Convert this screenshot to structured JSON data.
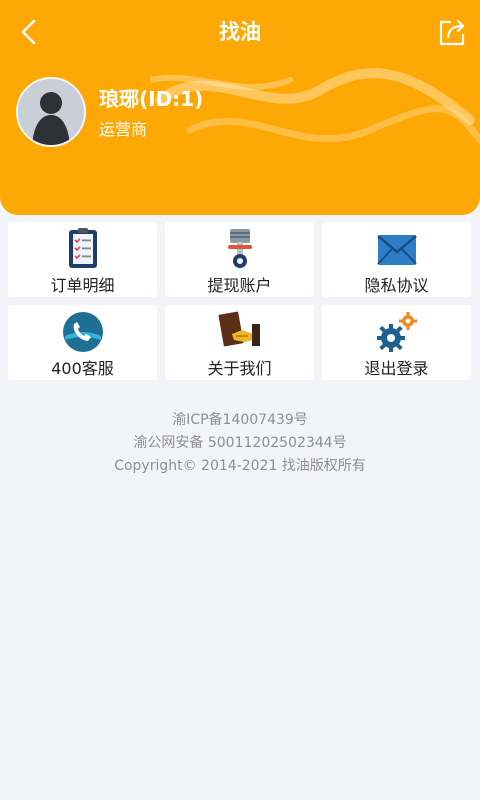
{
  "navbar": {
    "title": "找油",
    "back_icon": "chevron-left-icon",
    "share_icon": "share-icon"
  },
  "user": {
    "name": "琅琊(ID:1)",
    "role": "运营商"
  },
  "menu": [
    {
      "label": "订单明细",
      "icon": "clipboard-checklist-icon"
    },
    {
      "label": "提现账户",
      "icon": "piston-icon"
    },
    {
      "label": "隐私协议",
      "icon": "envelope-icon"
    },
    {
      "label": "400客服",
      "icon": "phone-icon"
    },
    {
      "label": "关于我们",
      "icon": "handshake-icon"
    },
    {
      "label": "退出登录",
      "icon": "gears-icon"
    }
  ],
  "footer": {
    "icp": "渝ICP备14007439号",
    "security": "渝公网安备 50011202502344号",
    "copyright": "Copyright© 2014-2021 找油版权所有"
  },
  "colors": {
    "header_bg": "#fda804",
    "page_bg": "#f3f4f8"
  }
}
